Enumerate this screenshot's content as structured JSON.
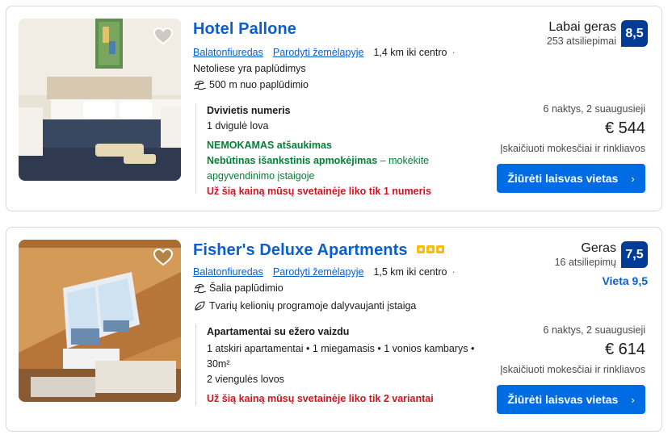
{
  "hotels": [
    {
      "name": "Hotel Pallone",
      "stars": 0,
      "city": "Balatonfiuredas",
      "map_link": "Parodyti žemėlapyje",
      "distance": "1,4 km iki centro",
      "features": [
        "Netoliese yra paplūdimys",
        "500 m nuo paplūdimio"
      ],
      "room_name": "Dvivietis numeris",
      "room_details": [
        "1 dvigulė lova"
      ],
      "free_cancel": "NEMOKAMAS atšaukimas",
      "prepay_bold": "Nebūtinas išankstinis apmokėjimas",
      "prepay_rest": " – mokėkite apgyvendinimo įstaigoje",
      "urgency": "Už šią kainą mūsų svetainėje liko tik 1 numeris",
      "score_word": "Labai geras",
      "review_count": "253 atsiliepimai",
      "score": "8,5",
      "location_score": "",
      "nights": "6 naktys, 2 suaugusieji",
      "price": "€ 544",
      "taxes": "Įskaičiuoti mokesčiai ir rinkliavos",
      "button": "Žiūrėti laisvas vietas"
    },
    {
      "name": "Fisher's Deluxe Apartments",
      "stars": 3,
      "city": "Balatonfiuredas",
      "map_link": "Parodyti žemėlapyje",
      "distance": "1,5 km iki centro",
      "features": [
        "Šalia paplūdimio",
        "Tvarių kelionių programoje dalyvaujanti įstaiga"
      ],
      "room_name": "Apartamentai su ežero vaizdu",
      "room_details": [
        "1 atskiri apartamentai • 1 miegamasis • 1 vonios kambarys • 30m²",
        "2 viengulės lovos"
      ],
      "urgency": "Už šią kainą mūsų svetainėje liko tik 2 variantai",
      "score_word": "Geras",
      "review_count": "16 atsiliepimų",
      "score": "7,5",
      "location_score": "Vieta 9,5",
      "nights": "6 naktys, 2 suaugusieji",
      "price": "€ 614",
      "taxes": "Įskaičiuoti mokesčiai ir rinkliavos",
      "button": "Žiūrėti laisvas vietas"
    }
  ],
  "colors": {
    "link_blue": "#0b5fcc",
    "score_navy": "#003b95",
    "button_blue": "#006ce4",
    "green": "#008234",
    "red": "#d4111e",
    "star_yellow": "#febb02"
  },
  "icons": [
    "heart-icon",
    "beach-icon",
    "leaf-icon",
    "chevron-right-icon",
    "star-icon"
  ]
}
